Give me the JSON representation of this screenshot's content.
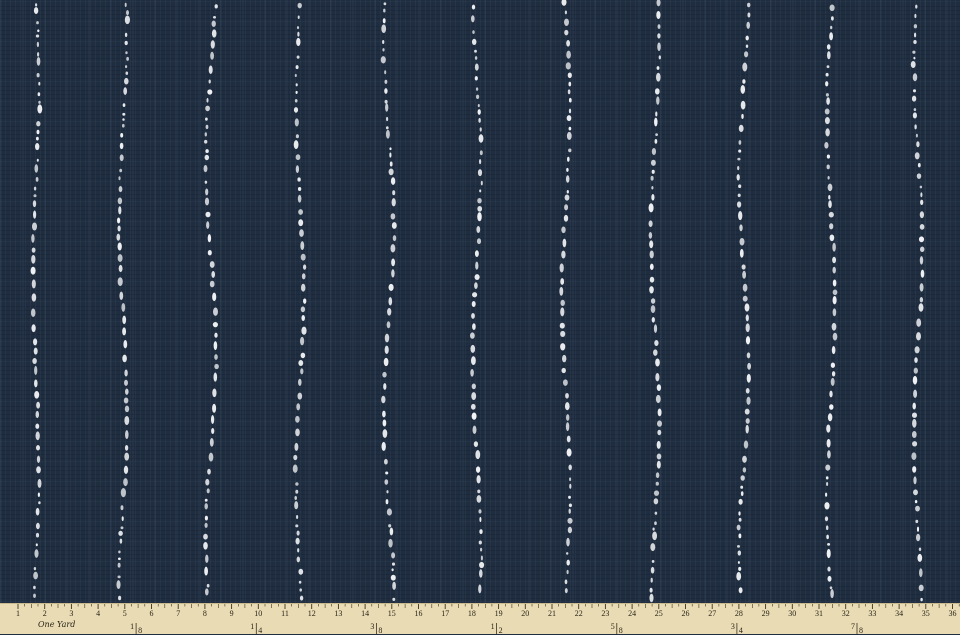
{
  "photo": {
    "subject": "navy fabric with white dotted vertical stripes",
    "colors": {
      "fabric": "#1f2d40",
      "dots": "#f2f4f6",
      "ruler": "#e9dcb5"
    }
  },
  "ruler": {
    "brand_text": "One Yard",
    "inch_labels": [
      "1",
      "2",
      "3",
      "4",
      "5",
      "6",
      "7",
      "8",
      "9",
      "10",
      "11",
      "12",
      "13",
      "14",
      "15",
      "16",
      "17",
      "18",
      "19",
      "20",
      "21",
      "22",
      "23",
      "24",
      "25",
      "26",
      "27",
      "28",
      "29",
      "30",
      "31",
      "32",
      "33",
      "34",
      "35",
      "36"
    ],
    "fraction_labels": [
      {
        "num": "1",
        "den": "8"
      },
      {
        "num": "1",
        "den": "4"
      },
      {
        "num": "3",
        "den": "8"
      },
      {
        "num": "1",
        "den": "2"
      },
      {
        "num": "5",
        "den": "8"
      },
      {
        "num": "3",
        "den": "4"
      },
      {
        "num": "7",
        "den": "8"
      }
    ]
  }
}
